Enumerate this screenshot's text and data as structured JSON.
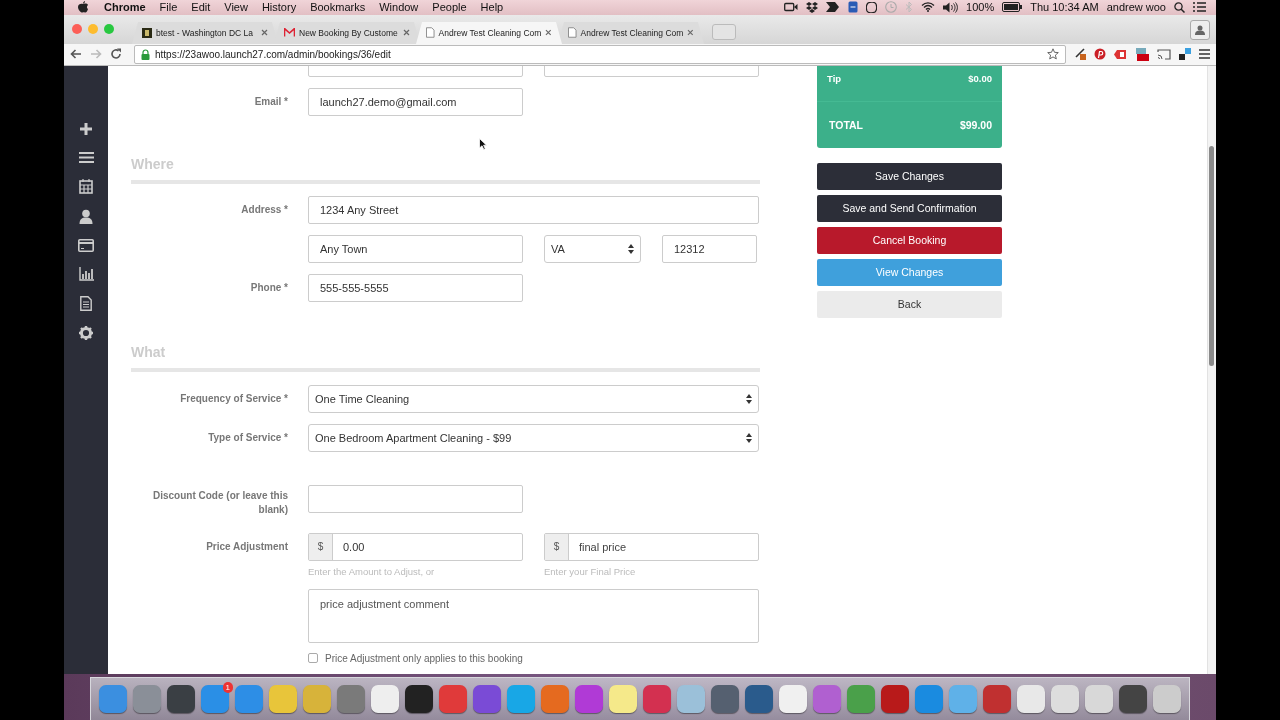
{
  "menu_bar": {
    "app": "Chrome",
    "menus": [
      "File",
      "Edit",
      "View",
      "History",
      "Bookmarks",
      "Window",
      "People",
      "Help"
    ],
    "battery": "100%",
    "clock": "Thu 10:34 AM",
    "user": "andrew woo"
  },
  "browser": {
    "tabs": [
      {
        "title": "btest - Washington DC La",
        "kind": "site",
        "selected": false
      },
      {
        "title": "New Booking By Custome",
        "kind": "mail",
        "selected": false
      },
      {
        "title": "Andrew Test Cleaning Com",
        "kind": "page",
        "selected": true
      },
      {
        "title": "Andrew Test Cleaning Com",
        "kind": "page",
        "selected": false
      }
    ],
    "url": "https://23awoo.launch27.com/admin/bookings/36/edit"
  },
  "form": {
    "email": {
      "label": "Email *",
      "value": "launch27.demo@gmail.com"
    },
    "where": {
      "heading": "Where",
      "address_label": "Address *",
      "street": "1234 Any Street",
      "city": "Any Town",
      "state": "VA",
      "zip": "12312",
      "phone_label": "Phone *",
      "phone": "555-555-5555"
    },
    "what": {
      "heading": "What",
      "frequency": {
        "label": "Frequency of Service *",
        "value": "One Time Cleaning"
      },
      "service_type": {
        "label": "Type of Service *",
        "value": "One Bedroom Apartment Cleaning - $99"
      },
      "discount": {
        "label": "Discount Code (or leave this blank)"
      },
      "price_adjustment": {
        "label": "Price Adjustment",
        "amount_currency": "$",
        "amount": "0.00",
        "amount_help": "Enter the Amount to Adjust, or",
        "final_currency": "$",
        "final_placeholder": "final price",
        "final_help": "Enter your Final Price",
        "comment_placeholder": "price adjustment comment",
        "only_this_booking": {
          "label": "Price Adjustment only applies to this booking",
          "checked": false
        }
      }
    }
  },
  "summary": {
    "rows": [
      {
        "label": "Tip",
        "value": "$0.00",
        "kind": "line"
      },
      {
        "label": "TOTAL",
        "value": "$99.00",
        "kind": "total"
      }
    ]
  },
  "actions": [
    {
      "label": "Save Changes",
      "kind": "dark"
    },
    {
      "label": "Save and Send Confirmation",
      "kind": "dark"
    },
    {
      "label": "Cancel Booking",
      "kind": "danger"
    },
    {
      "label": "View Changes",
      "kind": "info"
    },
    {
      "label": "Back",
      "kind": "default"
    }
  ],
  "dock": {
    "apps": [
      {
        "color": "#3b8fe0"
      },
      {
        "color": "#8a8f98"
      },
      {
        "color": "#3a3f44"
      },
      {
        "color": "#2a8fe6",
        "badge": "1"
      },
      {
        "color": "#2d8ee6"
      },
      {
        "color": "#e8c53a"
      },
      {
        "color": "#d7b33a"
      },
      {
        "color": "#7a7a7a"
      },
      {
        "color": "#eeeeee"
      },
      {
        "color": "#222222"
      },
      {
        "color": "#e03a3a"
      },
      {
        "color": "#7a4bd6"
      },
      {
        "color": "#18a7e6"
      },
      {
        "color": "#e56a1f"
      },
      {
        "color": "#b03ad6"
      },
      {
        "color": "#f5e98a"
      },
      {
        "color": "#d33050"
      },
      {
        "color": "#9bc0d9"
      },
      {
        "color": "#556070"
      },
      {
        "color": "#2a5b8c"
      },
      {
        "color": "#f0f0f0"
      },
      {
        "color": "#b060d0"
      },
      {
        "color": "#4aa04a"
      },
      {
        "color": "#b81a1a"
      },
      {
        "color": "#1a8be0"
      },
      {
        "color": "#5fb1e8"
      },
      {
        "color": "#c03030"
      },
      {
        "color": "#e8e8e8"
      },
      {
        "color": "#dddddd"
      },
      {
        "color": "#d8d8d8"
      },
      {
        "color": "#444444"
      },
      {
        "color": "#cccccc"
      }
    ]
  }
}
